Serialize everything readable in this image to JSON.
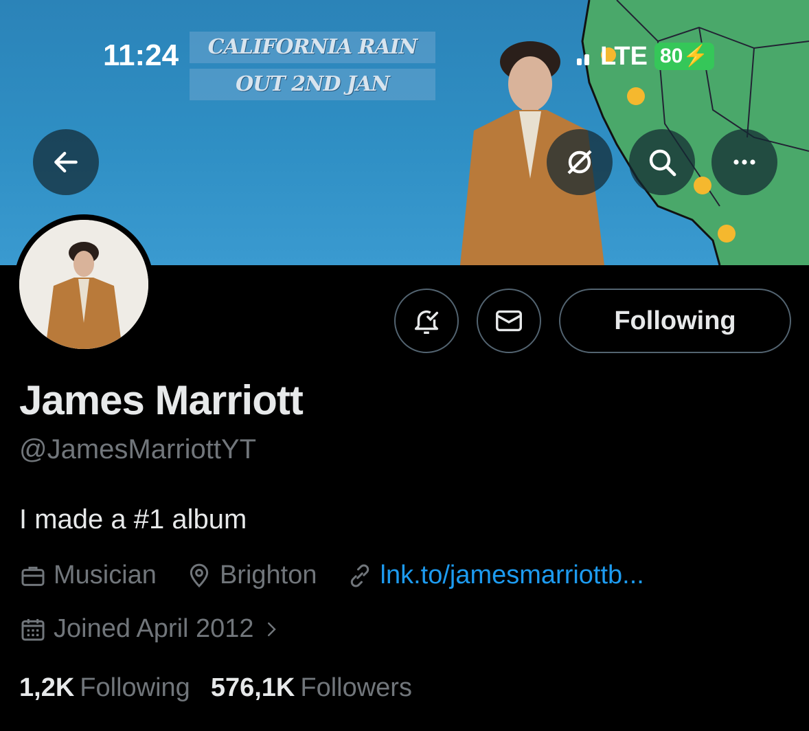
{
  "banner": {
    "line1": "CALIFORNIA RAIN",
    "line2": "OUT 2ND JAN"
  },
  "status_bar": {
    "time": "11:24",
    "network": "LTE",
    "battery": "80"
  },
  "profile": {
    "name": "James Marriott",
    "handle": "@JamesMarriottYT",
    "bio": "I made a #1 album",
    "occupation": "Musician",
    "location": "Brighton",
    "link": "lnk.to/jamesmarriottb...",
    "joined": "Joined April 2012",
    "following_count": "1,2K",
    "following_label": "Following",
    "followers_count": "576,1K",
    "followers_label": "Followers"
  },
  "actions": {
    "following_button": "Following"
  },
  "colors": {
    "accent_link": "#1d9bf0",
    "muted_text": "#71767b",
    "battery_green": "#35c759"
  }
}
